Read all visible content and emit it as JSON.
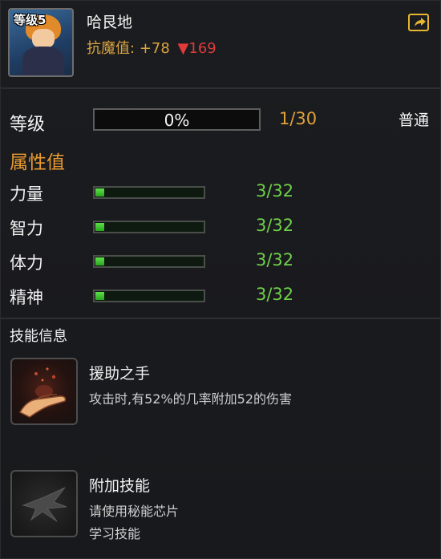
{
  "header": {
    "portrait_badge": "等级5",
    "name": "哈艮地",
    "resist_label": "抗魔值:",
    "resist_value": "+78",
    "resist_delta": "▼169"
  },
  "level": {
    "label": "等级",
    "progress_text": "0%",
    "progress": 0,
    "count": "1/30",
    "grade": "普通"
  },
  "attributes": {
    "title": "属性值",
    "items": [
      {
        "label": "力量",
        "value": "3/32",
        "fraction": 0.09375
      },
      {
        "label": "智力",
        "value": "3/32",
        "fraction": 0.09375
      },
      {
        "label": "体力",
        "value": "3/32",
        "fraction": 0.09375
      },
      {
        "label": "精神",
        "value": "3/32",
        "fraction": 0.09375
      }
    ]
  },
  "skills": {
    "title": "技能信息",
    "items": [
      {
        "name": "援助之手",
        "desc": [
          "攻击时,有52%的几率附加52的伤害"
        ],
        "icon": "helping-hand-icon"
      },
      {
        "name": "附加技能",
        "desc": [
          "请使用秘能芯片",
          "学习技能"
        ],
        "icon": "locked-skill-icon"
      }
    ]
  },
  "colors": {
    "accent_orange": "#e89a2e",
    "value_green": "#6fd04a",
    "delta_red": "#e03a3a",
    "share_yellow": "#e7b530"
  }
}
